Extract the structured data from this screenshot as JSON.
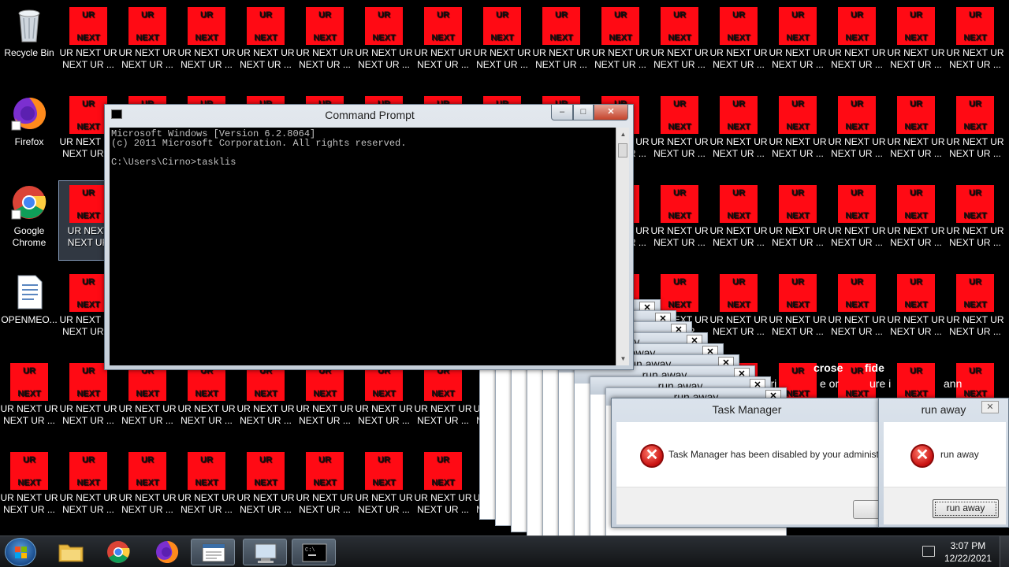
{
  "desktop": {
    "system_icons": [
      {
        "label": "Recycle Bin",
        "icon": "recycle-bin-icon"
      },
      {
        "label": "Firefox",
        "icon": "firefox-icon"
      },
      {
        "label": "Google Chrome",
        "icon": "chrome-icon"
      },
      {
        "label": "OPENMEO...",
        "icon": "document-icon"
      }
    ],
    "ur_icon": {
      "top": "UR",
      "bottom": "NEXT",
      "label_line1": "UR NEXT UR",
      "label_line2": "NEXT UR ..."
    },
    "ur_icon_selected": {
      "label_line1": "UR NEXT",
      "label_line2": "NEXT UR"
    }
  },
  "cmd": {
    "title": "Command Prompt",
    "lines": [
      "Microsoft Windows [Version 6.2.8064]",
      "(c) 2011 Microsoft Corporation. All rights reserved.",
      "",
      "C:\\Users\\Cirno>tasklis"
    ],
    "minimize": "–",
    "maximize": "□",
    "close": "✕"
  },
  "cascade": {
    "title": "run away",
    "close": "✕"
  },
  "background_text": [
    "crose",
    "fide",
    "thori",
    "e or",
    "ure i",
    "ann"
  ],
  "task_manager": {
    "title": "Task Manager",
    "message": "Task Manager has been disabled by your administ"
  },
  "run_away_dialog": {
    "title": "run away",
    "close": "✕",
    "message": "run away",
    "button": "run away"
  },
  "taskbar": {
    "apps": [
      "explorer",
      "chrome",
      "firefox",
      "document-viewer",
      "computer",
      "command-prompt"
    ],
    "time": "3:07 PM",
    "date": "12/22/2021"
  },
  "colors": {
    "ur_red": "#ff0a14",
    "console_bg": "#000000"
  }
}
